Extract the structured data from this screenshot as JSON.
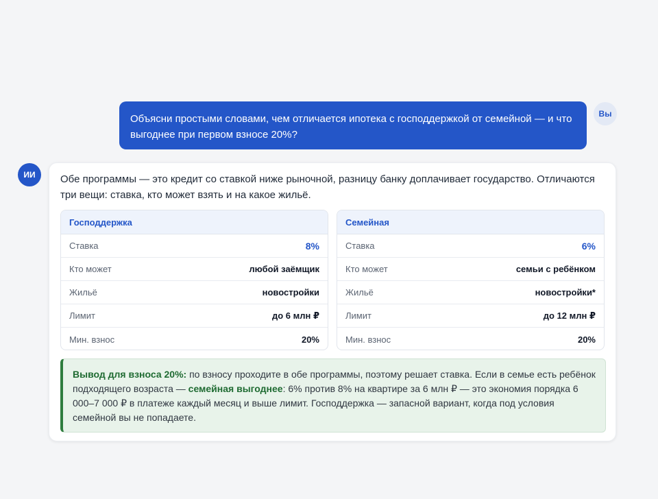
{
  "user": {
    "avatar_label": "Вы",
    "message": "Объясни простыми словами, чем отличается ипотека с господдержкой от семейной — и что выгоднее при первом взносе 20%?"
  },
  "assistant": {
    "avatar_label": "ИИ",
    "intro": "Обе программы — это кредит со ставкой ниже рыночной, разницу банку доплачивает государство. Отличаются три вещи: ставка, кто может взять и на какое жильё.",
    "panels": [
      {
        "title": "Господдержка",
        "rows": [
          {
            "label": "Ставка",
            "value": "8%"
          },
          {
            "label": "Кто может",
            "value": "любой заёмщик"
          },
          {
            "label": "Жильё",
            "value": "новостройки"
          },
          {
            "label": "Лимит",
            "value": "до 6 млн ₽"
          },
          {
            "label": "Мин. взнос",
            "value": "20%"
          }
        ]
      },
      {
        "title": "Семейная",
        "rows": [
          {
            "label": "Ставка",
            "value": "6%"
          },
          {
            "label": "Кто может",
            "value": "семьи с ребёнком"
          },
          {
            "label": "Жильё",
            "value": "новостройки*"
          },
          {
            "label": "Лимит",
            "value": "до 12 млн ₽"
          },
          {
            "label": "Мин. взнос",
            "value": "20%"
          }
        ]
      }
    ],
    "conclusion": {
      "lead": "Вывод для взноса 20%:",
      "part1": " по взносу проходите в обе программы, поэтому решает ставка. Если в семье есть ребёнок подходящего возраста — ",
      "highlight": "семейная выгоднее",
      "part2": ": 6% против 8% на квартире за 6 млн ₽ — это экономия порядка 6 000–7 000 ₽ в платеже каждый месяц и выше лимит. Господдержка — запасной вариант, когда под условия семейной вы не попадаете."
    }
  },
  "colors": {
    "accent": "#2456c8",
    "success": "#2e7d3e",
    "background": "#f4f5f7"
  }
}
